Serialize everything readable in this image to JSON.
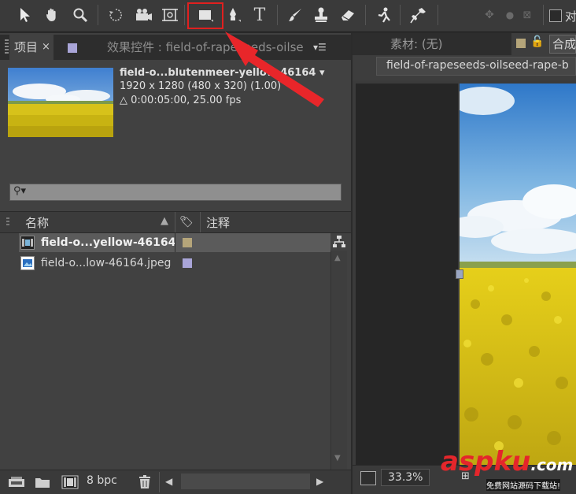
{
  "toolbar": {
    "tools": [
      "selection-tool",
      "hand-tool",
      "zoom-tool",
      "rotation-tool",
      "camera-tool",
      "pan-behind-tool",
      "rectangle-tool",
      "pen-tool",
      "type-tool",
      "brush-tool",
      "clone-stamp-tool",
      "eraser-tool",
      "roto-brush-tool",
      "puppet-tool"
    ],
    "right_label": "对"
  },
  "project_panel": {
    "tab_project": "项目",
    "tab_close": "×",
    "tab_effects": "效果控件 : field-of-rapeseeds-oilse",
    "item_name": "field-o...blutenmeer-yellow-46164 ▾",
    "dimensions": "1920 x 1280  (480 x 320) (1.00)",
    "duration": "△ 0:00:05:00, 25.00 fps",
    "search_placeholder": "",
    "col_name": "名称",
    "col_comment": "注释",
    "items": [
      {
        "name": "field-o...yellow-46164",
        "label_color": "#b5a57a",
        "type": "composition"
      },
      {
        "name": "field-o...low-46164.jpeg",
        "label_color": "#a9a5d8",
        "type": "footage"
      }
    ],
    "bpc": "8 bpc"
  },
  "viewer": {
    "tab_footage": "素材: (无)",
    "tab_comp": "合成",
    "comp_name": "field-of-rapeseeds-oilseed-rape-b",
    "zoom": "33.3%"
  },
  "watermark": {
    "brand": "aspku",
    "domain_suffix": ".com",
    "slogan": "免费网站源码下载站!"
  },
  "colors": {
    "highlight": "#e0201f",
    "arrow": "#e8262a",
    "panel_bg": "#414141"
  }
}
